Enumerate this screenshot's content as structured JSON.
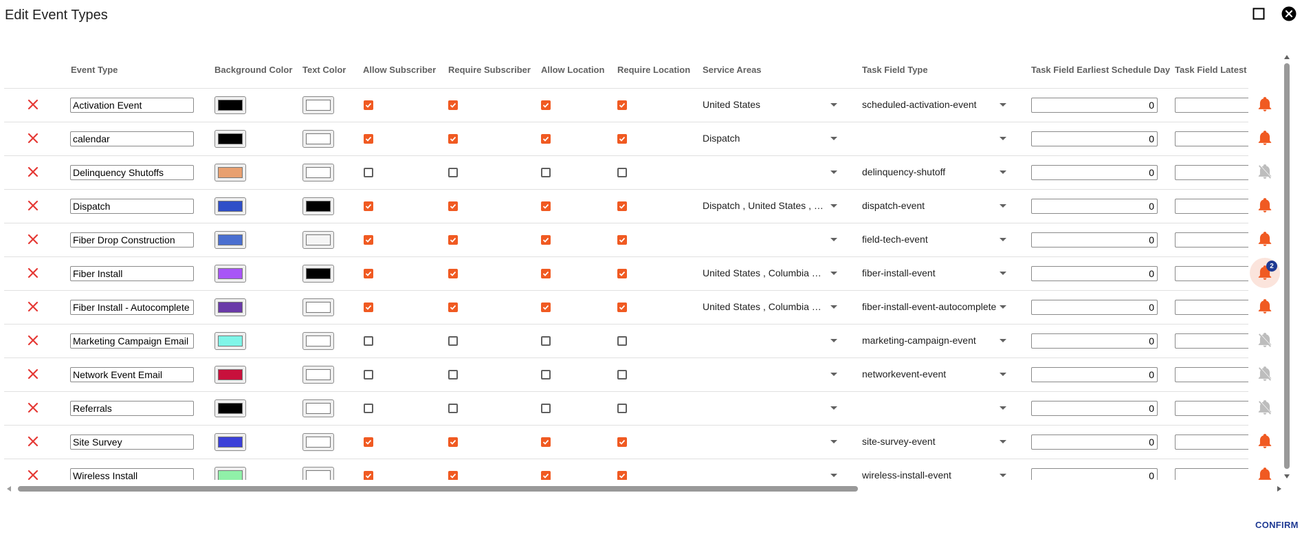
{
  "title": "Edit Event Types",
  "headers": {
    "event_type": "Event Type",
    "background_color": "Background Color",
    "text_color": "Text Color",
    "allow_subscriber": "Allow Subscriber",
    "require_subscriber": "Require Subscriber",
    "allow_location": "Allow Location",
    "require_location": "Require Location",
    "service_areas": "Service Areas",
    "task_field_type": "Task Field Type",
    "task_field_earliest": "Task Field Earliest Schedule Day",
    "task_field_latest": "Task Field Latest Sc"
  },
  "rows": [
    {
      "name": "Activation Event",
      "bg": "#000000",
      "fg": "#ffffff",
      "checks": [
        true,
        true,
        true,
        true
      ],
      "areas": "United States",
      "task": "scheduled-activation-event",
      "earliest": "0",
      "bell": "on"
    },
    {
      "name": "calendar",
      "bg": "#000000",
      "fg": "#ffffff",
      "checks": [
        true,
        true,
        true,
        true
      ],
      "areas": "Dispatch",
      "task": "",
      "earliest": "0",
      "bell": "on"
    },
    {
      "name": "Delinquency Shutoffs",
      "bg": "#e8a070",
      "fg": "#ffffff",
      "checks": [
        false,
        false,
        false,
        false
      ],
      "areas": "",
      "task": "delinquency-shutoff",
      "earliest": "0",
      "bell": "off"
    },
    {
      "name": "Dispatch",
      "bg": "#2f4fc8",
      "fg": "#000000",
      "checks": [
        true,
        true,
        true,
        true
      ],
      "areas": "Dispatch , United States , C...",
      "task": "dispatch-event",
      "earliest": "0",
      "bell": "on"
    },
    {
      "name": "Fiber Drop Construction",
      "bg": "#4a6fd0",
      "fg": "#f5f5f5",
      "checks": [
        true,
        true,
        true,
        true
      ],
      "areas": "",
      "task": "field-tech-event",
      "earliest": "0",
      "bell": "on"
    },
    {
      "name": "Fiber Install",
      "bg": "#a855f7",
      "fg": "#000000",
      "checks": [
        true,
        true,
        true,
        true
      ],
      "areas": "United States , Columbia N...",
      "task": "fiber-install-event",
      "earliest": "0",
      "bell": "on",
      "badge": "2"
    },
    {
      "name": "Fiber Install - Autocomplete",
      "bg": "#6a3aa8",
      "fg": "#ffffff",
      "checks": [
        true,
        true,
        true,
        true
      ],
      "areas": "United States , Columbia N...",
      "task": "fiber-install-event-autocomplete",
      "earliest": "0",
      "bell": "on"
    },
    {
      "name": "Marketing Campaign Email",
      "bg": "#7ff5e8",
      "fg": "#ffffff",
      "checks": [
        false,
        false,
        false,
        false
      ],
      "areas": "",
      "task": "marketing-campaign-event",
      "earliest": "0",
      "bell": "off"
    },
    {
      "name": "Network Event Email",
      "bg": "#c8103c",
      "fg": "#ffffff",
      "checks": [
        false,
        false,
        false,
        false
      ],
      "areas": "",
      "task": "networkevent-event",
      "earliest": "0",
      "bell": "off"
    },
    {
      "name": "Referrals",
      "bg": "#000000",
      "fg": "#ffffff",
      "checks": [
        false,
        false,
        false,
        false
      ],
      "areas": "",
      "task": "",
      "earliest": "0",
      "bell": "off"
    },
    {
      "name": "Site Survey",
      "bg": "#3b40d8",
      "fg": "#ffffff",
      "checks": [
        true,
        true,
        true,
        true
      ],
      "areas": "",
      "task": "site-survey-event",
      "earliest": "0",
      "bell": "on"
    },
    {
      "name": "Wireless Install",
      "bg": "#90f0a8",
      "fg": "#ffffff",
      "checks": [
        true,
        true,
        true,
        true
      ],
      "areas": "",
      "task": "wireless-install-event",
      "earliest": "0",
      "bell": "on"
    }
  ],
  "confirm_label": "CONFIRM",
  "colors": {
    "accent": "#f05a22",
    "primary": "#1f3a93",
    "delete": "#e53935"
  },
  "icons": {
    "delete": "close-x-icon",
    "bell_on": "bell-icon",
    "bell_off": "bell-off-icon",
    "maximize": "maximize-icon",
    "close": "close-circle-icon"
  }
}
